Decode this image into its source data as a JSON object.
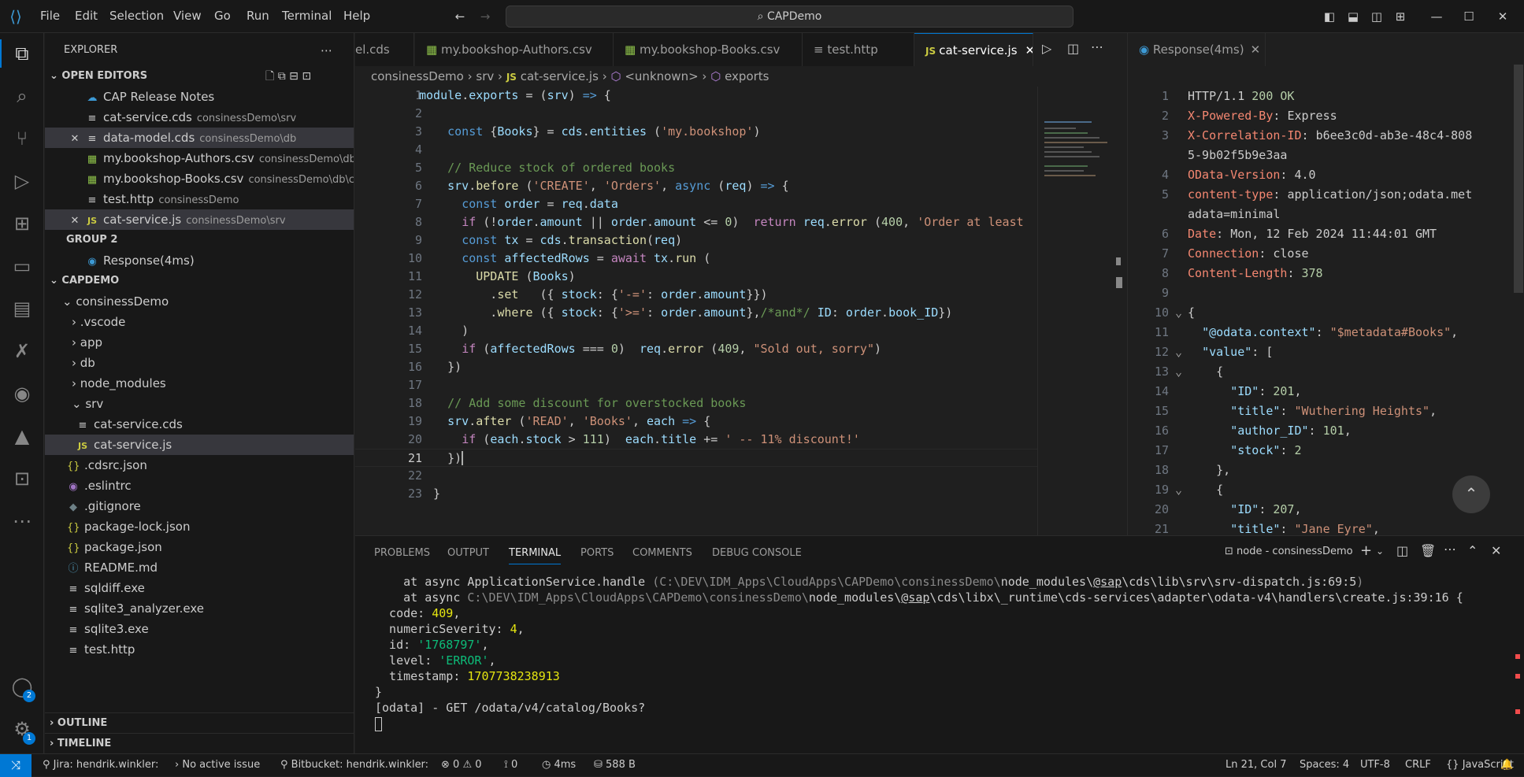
{
  "title": {
    "menus": [
      "File",
      "Edit",
      "Selection",
      "View",
      "Go",
      "Run",
      "Terminal",
      "Help"
    ],
    "search_text": "CAPDemo"
  },
  "explorer": {
    "header": "EXPLORER",
    "open_editors_label": "OPEN EDITORS",
    "open_editors": [
      {
        "name": "CAP Release Notes",
        "path": ""
      },
      {
        "name": "cat-service.cds",
        "path": "consinessDemo\\srv"
      },
      {
        "name": "data-model.cds",
        "path": "consinessDemo\\db"
      },
      {
        "name": "my.bookshop-Authors.csv",
        "path": "consinessDemo\\db..."
      },
      {
        "name": "my.bookshop-Books.csv",
        "path": "consinessDemo\\db\\c..."
      },
      {
        "name": "test.http",
        "path": "consinessDemo"
      },
      {
        "name": "cat-service.js",
        "path": "consinessDemo\\srv"
      }
    ],
    "group2_label": "GROUP 2",
    "group2_item": "Response(4ms)",
    "project_label": "CAPDEMO",
    "tree": [
      "consinessDemo",
      ".vscode",
      "app",
      "db",
      "node_modules",
      "srv",
      "cat-service.cds",
      "cat-service.js",
      ".cdsrc.json",
      ".eslintrc",
      ".gitignore",
      "package-lock.json",
      "package.json",
      "README.md",
      "sqldiff.exe",
      "sqlite3_analyzer.exe",
      "sqlite3.exe",
      "test.http"
    ],
    "outline_label": "OUTLINE",
    "timeline_label": "TIMELINE"
  },
  "editor": {
    "tabs": [
      "el.cds",
      "my.bookshop-Authors.csv",
      "my.bookshop-Books.csv",
      "test.http",
      "cat-service.js"
    ],
    "breadcrumb": [
      "consinessDemo",
      "srv",
      "cat-service.js",
      "<unknown>",
      "exports"
    ],
    "current_line": 21
  },
  "response": {
    "tab_label": "Response(4ms)",
    "lines": [
      {
        "k": "HTTP/1.1 ",
        "v": "200 OK"
      },
      {
        "k": "X-Powered-By",
        "v": "Express"
      },
      {
        "k": "X-Correlation-ID",
        "v": "b6ee3c0d-ab3e-48c4-808"
      },
      {
        "k": "",
        "v": "5-9b02f5b9e3aa"
      },
      {
        "k": "OData-Version",
        "v": "4.0"
      },
      {
        "k": "content-type",
        "v": "application/json;odata.met"
      },
      {
        "k": "",
        "v": "adata=minimal"
      },
      {
        "k": "Date",
        "v": "Mon, 12 Feb 2024 11:44:01 GMT"
      },
      {
        "k": "Connection",
        "v": "close"
      },
      {
        "k": "Content-Length",
        "v": "378"
      }
    ]
  },
  "panel": {
    "tabs": [
      "PROBLEMS",
      "OUTPUT",
      "TERMINAL",
      "PORTS",
      "COMMENTS",
      "DEBUG CONSOLE"
    ],
    "terminal_name": "node - consinessDemo"
  },
  "status": {
    "jira": "Jira: hendrik.winkler:",
    "issue": "No active issue",
    "bitbucket": "Bitbucket: hendrik.winkler:",
    "errors": "0",
    "warnings": "0",
    "ports": "0",
    "time": "4ms",
    "size": "588 B",
    "position": "Ln 21, Col 7",
    "spaces": "Spaces: 4",
    "encoding": "UTF-8",
    "eol": "CRLF",
    "language": "JavaScript"
  },
  "badges": {
    "accounts": "2",
    "settings": "1"
  }
}
